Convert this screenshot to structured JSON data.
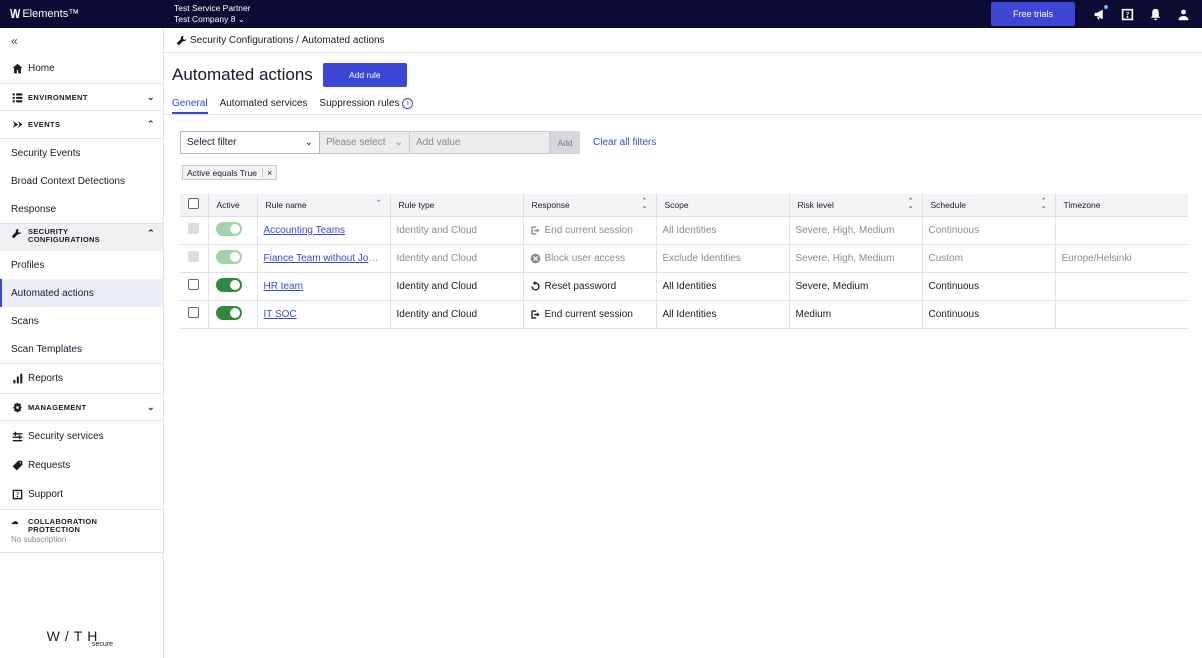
{
  "topbar": {
    "logo_mark": "\\/\\/",
    "logo_text": "Elements™",
    "partner": "Test Service Partner",
    "company": "Test Company 8",
    "free_trials": "Free trials"
  },
  "sidebar": {
    "collapse": "«",
    "home": "Home",
    "environment": "ENVIRONMENT",
    "events": "EVENTS",
    "events_items": [
      "Security Events",
      "Broad Context Detections",
      "Response"
    ],
    "security_configurations_line1": "SECURITY",
    "security_configurations_line2": "CONFIGURATIONS",
    "config_items": [
      "Profiles",
      "Automated actions",
      "Scans",
      "Scan Templates"
    ],
    "reports": "Reports",
    "management": "MANAGEMENT",
    "security_services": "Security services",
    "requests": "Requests",
    "support": "Support",
    "collab_line1": "COLLABORATION",
    "collab_line2": "PROTECTION",
    "collab_sub": "No subscription",
    "brand": "W/TH",
    "brand_sub": "secure"
  },
  "breadcrumb": {
    "parent": "Security Configurations",
    "sep": "/",
    "current": "Automated actions"
  },
  "page": {
    "title": "Automated actions",
    "add_rule": "Add rule"
  },
  "tabs": [
    {
      "label": "General",
      "active": true
    },
    {
      "label": "Automated services",
      "active": false
    },
    {
      "label": "Suppression rules",
      "active": false
    }
  ],
  "filters": {
    "select_filter": "Select filter",
    "please_select": "Please select",
    "value_placeholder": "Add value",
    "add": "Add",
    "clear_all": "Clear all filters",
    "chip": "Active equals True"
  },
  "table": {
    "headers": [
      "Active",
      "Rule name",
      "Rule type",
      "Response",
      "Scope",
      "Risk level",
      "Schedule",
      "Timezone"
    ],
    "rows": [
      {
        "enabled": false,
        "active": true,
        "name": "Accounting Teams",
        "type": "Identity and Cloud",
        "response": "End current session",
        "response_icon": "logout-icon",
        "scope": "All Identities",
        "risk": "Severe, High, Medium",
        "schedule": "Continuous",
        "timezone": ""
      },
      {
        "enabled": false,
        "active": true,
        "name": "Fiance Team without Johnny",
        "type": "Identity and Cloud",
        "response": "Block user access",
        "response_icon": "block-icon",
        "scope": "Exclude Identities",
        "risk": "Severe, High, Medium",
        "schedule": "Custom",
        "timezone": "Europe/Helsinki"
      },
      {
        "enabled": true,
        "active": true,
        "name": "HR team",
        "type": "Identity and Cloud",
        "response": "Reset password",
        "response_icon": "reset-icon",
        "scope": "All Identities",
        "risk": "Severe, Medium",
        "schedule": "Continuous",
        "timezone": ""
      },
      {
        "enabled": true,
        "active": true,
        "name": "IT SOC",
        "type": "Identity and Cloud",
        "response": "End current session",
        "response_icon": "logout-icon",
        "scope": "All Identities",
        "risk": "Medium",
        "schedule": "Continuous",
        "timezone": ""
      }
    ]
  },
  "colors": {
    "brand": "#0b0b33",
    "accent": "#3d47d6",
    "toggle_on": "#2d8a3e"
  }
}
